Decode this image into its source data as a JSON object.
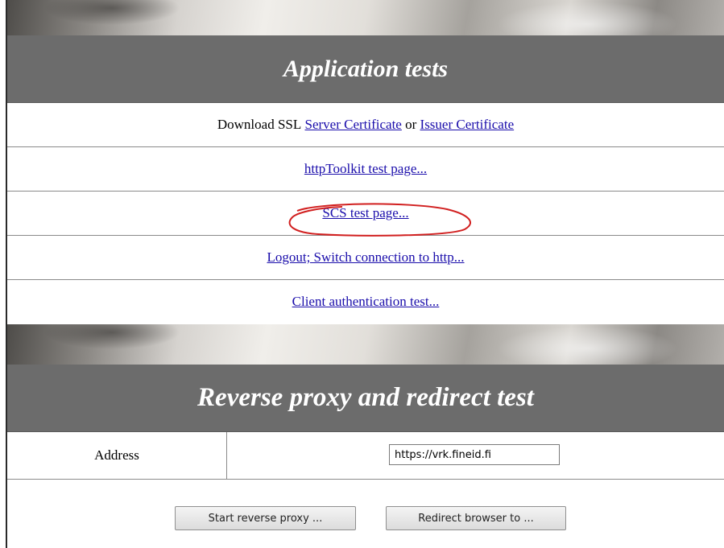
{
  "app_tests": {
    "title": "Application tests",
    "download_prefix": "Download SSL",
    "server_cert_link": "Server Certificate",
    "or_text": "or",
    "issuer_cert_link": "Issuer Certificate",
    "links": [
      "httpToolkit test page...",
      "SCS test page...",
      "Logout; Switch connection to http...",
      "Client authentication test..."
    ]
  },
  "annotation": {
    "color": "#d11f1f"
  },
  "proxy": {
    "title": "Reverse proxy and redirect test",
    "address_label": "Address",
    "address_value": "https://vrk.fineid.fi",
    "start_button": "Start reverse proxy ...",
    "redirect_button": "Redirect browser to ..."
  }
}
